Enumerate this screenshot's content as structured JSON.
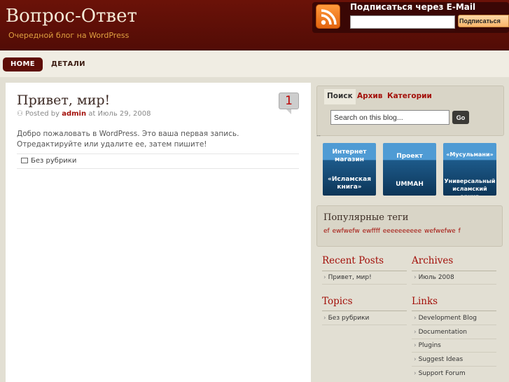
{
  "header": {
    "site_title": "Вопрос-Ответ",
    "site_description": "Очередной блог на WordPress",
    "subscribe_title": "Подписаться через E-Mail",
    "subscribe_button": "Подписаться",
    "subscribe_value": ""
  },
  "nav": {
    "home": "HOME",
    "details": "ДЕТАЛИ"
  },
  "post": {
    "title": "Привет, мир!",
    "comments": "1",
    "posted_by": "Posted by",
    "author": "admin",
    "at": "at",
    "date": "Июль 29, 2008",
    "body": "Добро пожаловать в WordPress. Это ваша первая запись. Отредактируйте или удалите ее, затем пишите!",
    "category": "Без рубрики"
  },
  "sidebar": {
    "tabs": [
      "Поиск",
      "Архив",
      "Категории"
    ],
    "search_value": "Search on this blog...",
    "search_button": "Go",
    "separator": "--",
    "banners": [
      {
        "top": "Интернет магазин",
        "bottom": "«Исламская книга»"
      },
      {
        "top": "Проект",
        "bottom": "UMMAH"
      },
      {
        "top": "«Мусульмани»",
        "bottom": "Универсальный исламский архив"
      }
    ],
    "tags_title": "Популярные теги",
    "tags": "ef ewfwefw ewffff eeeeeeeeee wefwefwe f",
    "recent_posts_title": "Recent Posts",
    "recent_posts": [
      "Привет, мир!"
    ],
    "archives_title": "Archives",
    "archives": [
      "Июль 2008"
    ],
    "topics_title": "Topics",
    "topics": [
      "Без рубрики"
    ],
    "links_title": "Links",
    "links": [
      "Development Blog",
      "Documentation",
      "Plugins",
      "Suggest Ideas",
      "Support Forum"
    ]
  },
  "colors": {
    "header_bg": "#5e0e07",
    "accent": "#a3100a",
    "body_bg": "#e2dfd3"
  }
}
